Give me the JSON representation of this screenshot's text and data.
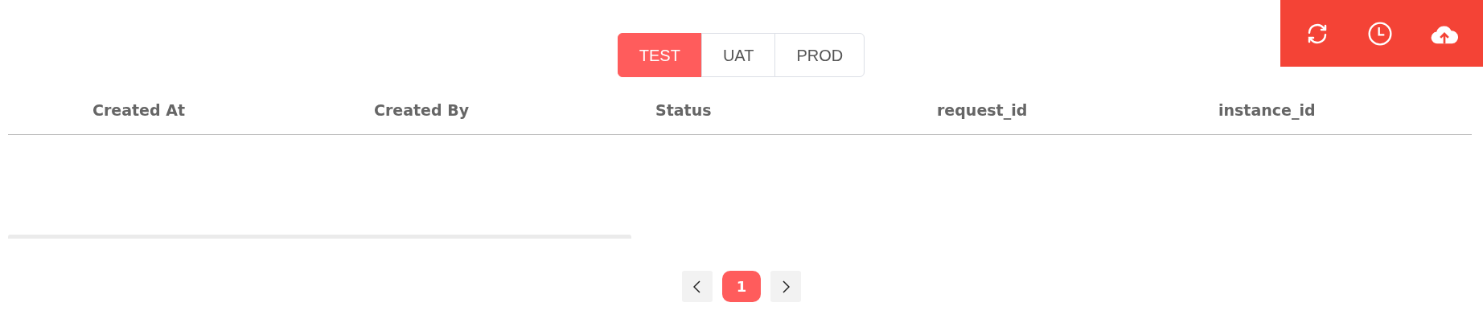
{
  "toolbar": {
    "buttons": [
      {
        "kind": "refresh"
      },
      {
        "kind": "history"
      },
      {
        "kind": "upload"
      }
    ]
  },
  "environments": [
    {
      "label": "TEST",
      "selected": true
    },
    {
      "label": "UAT",
      "selected": false
    },
    {
      "label": "PROD",
      "selected": false
    }
  ],
  "table": {
    "columns": [
      "Created At",
      "Created By",
      "Status",
      "request_id",
      "instance_id"
    ]
  },
  "pagination": {
    "pages": [
      {
        "label": "1",
        "selected": true
      }
    ]
  }
}
